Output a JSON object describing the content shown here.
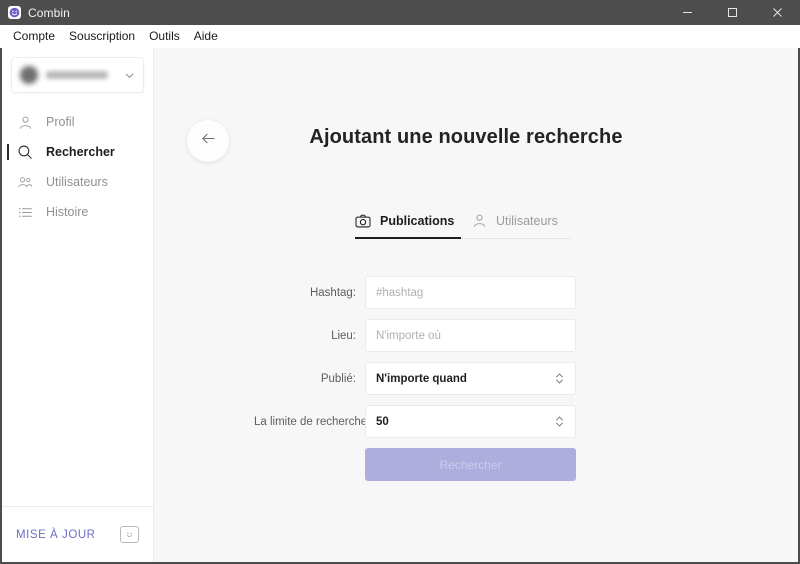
{
  "window": {
    "title": "Combin",
    "icon": "smiley-app-icon",
    "controls": {
      "minimize": "minimize-icon",
      "maximize": "maximize-icon",
      "close": "close-icon"
    }
  },
  "menubar": {
    "items": [
      {
        "label": "Compte"
      },
      {
        "label": "Souscription"
      },
      {
        "label": "Outils"
      },
      {
        "label": "Aide"
      }
    ]
  },
  "sidebar": {
    "account": {
      "name": "",
      "chevron": "chevron-down-icon"
    },
    "items": [
      {
        "label": "Profil",
        "icon": "user-icon",
        "active": false
      },
      {
        "label": "Rechercher",
        "icon": "search-icon",
        "active": true
      },
      {
        "label": "Utilisateurs",
        "icon": "users-icon",
        "active": false
      },
      {
        "label": "Histoire",
        "icon": "list-icon",
        "active": false
      }
    ],
    "footer": {
      "update_label": "MISE À JOUR",
      "update_icon": "smiley-chat-icon",
      "accent_color": "#6b6bc4"
    }
  },
  "main": {
    "back_button": "back-arrow-icon",
    "title": "Ajoutant une nouvelle recherche",
    "tabs": [
      {
        "label": "Publications",
        "icon": "camera-icon",
        "active": true
      },
      {
        "label": "Utilisateurs",
        "icon": "user-icon",
        "active": false
      }
    ],
    "form": {
      "fields": [
        {
          "label": "Hashtag:",
          "value": "",
          "placeholder": "#hashtag",
          "type": "text",
          "stepper": false
        },
        {
          "label": "Lieu:",
          "value": "",
          "placeholder": "N'importe où",
          "type": "text",
          "stepper": false
        },
        {
          "label": "Publié:",
          "value": "N'importe quand",
          "placeholder": "",
          "type": "select",
          "stepper": true
        },
        {
          "label": "La limite de recherche:",
          "value": "50",
          "placeholder": "",
          "type": "number",
          "stepper": true
        }
      ],
      "submit_label": "Rechercher",
      "submit_color": "#aeadde",
      "submit_disabled": true
    }
  }
}
